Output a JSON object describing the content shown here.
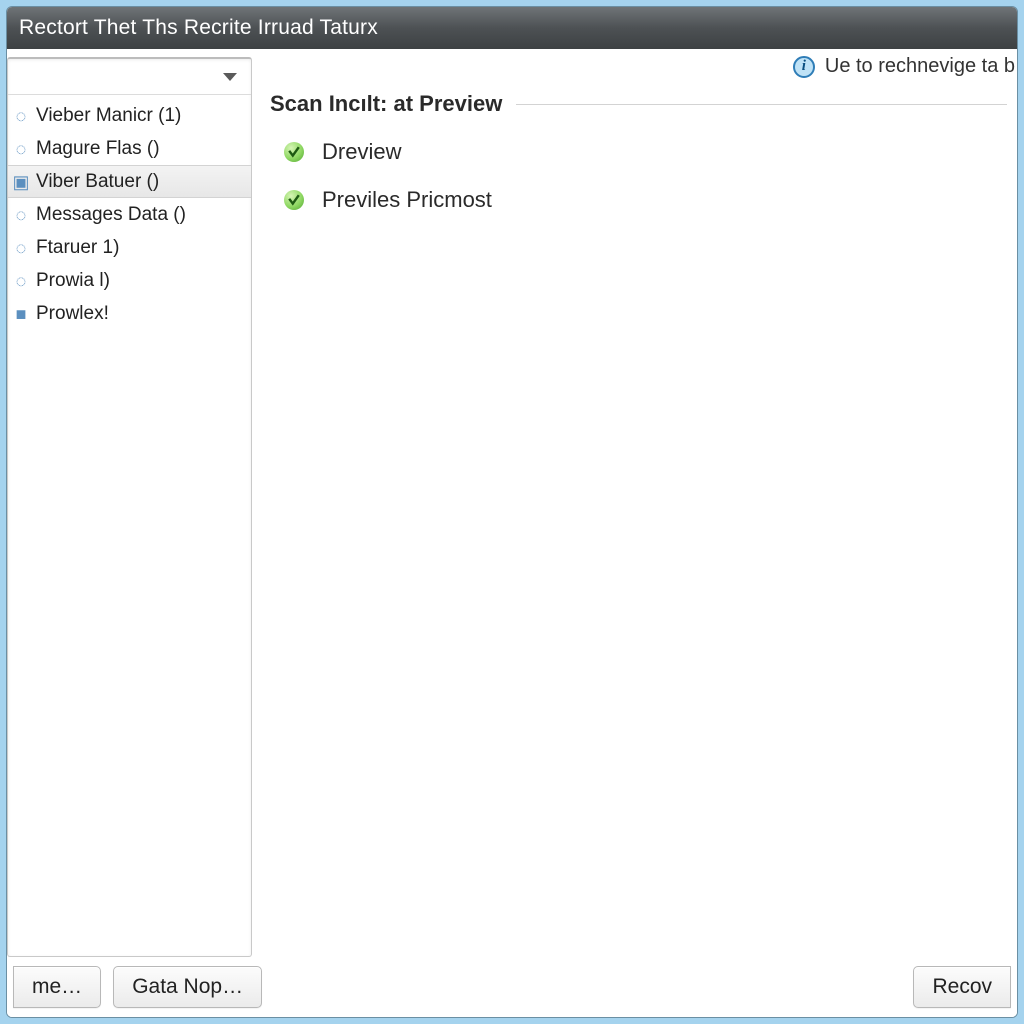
{
  "window": {
    "title": "Rectort Thet Ths Recrite Irruad Taturx"
  },
  "sidebar": {
    "items": [
      {
        "glyph": "◌",
        "label": "Vieber Manicr (1)"
      },
      {
        "glyph": "◌",
        "label": "Magure Flas ()"
      },
      {
        "glyph": "▣",
        "label": "Viber Batuer ()",
        "selected": true
      },
      {
        "glyph": "◌",
        "label": "Messages Data ()"
      },
      {
        "glyph": "◌",
        "label": "Ftaruer 1)"
      },
      {
        "glyph": "◌",
        "label": "Prowia l)"
      },
      {
        "glyph": "■",
        "label": "Prowlex!"
      }
    ]
  },
  "content": {
    "hint": "Ue to rechnevige ta b",
    "section_title": "Scan Incılt: at Preview",
    "results": [
      {
        "label": "Dreview"
      },
      {
        "label": "Previles Pricmost"
      }
    ]
  },
  "footer": {
    "btn1": "me…",
    "btn2": "Gata Nop…",
    "btn3": "Recov"
  }
}
